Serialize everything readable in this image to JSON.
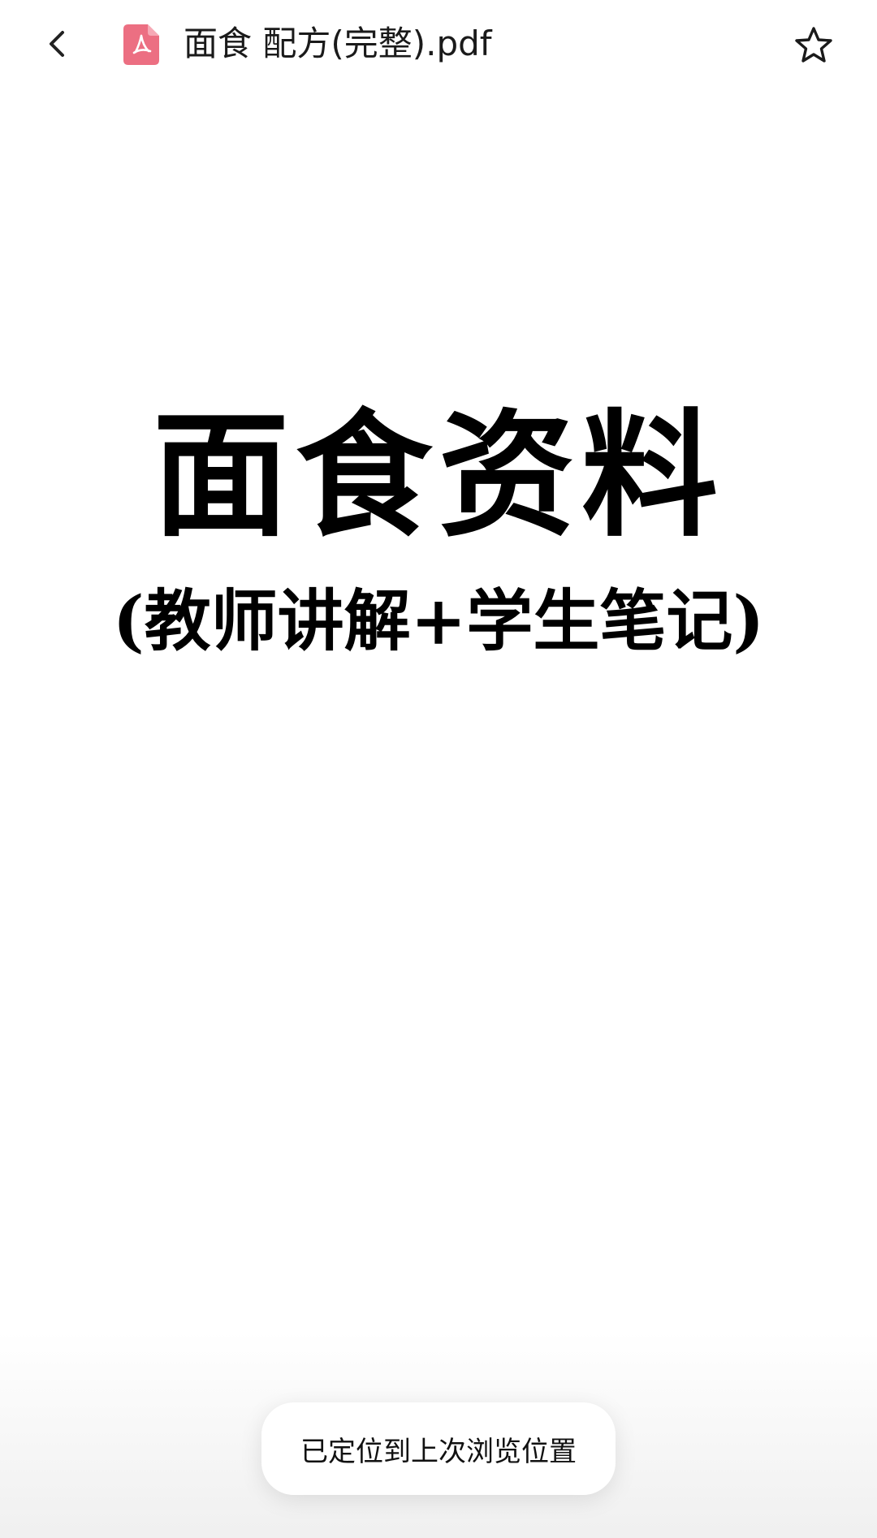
{
  "header": {
    "back_icon": "chevron-left-icon",
    "file_icon": "pdf-file-icon",
    "file_icon_color": "#e8677a",
    "title": "面食 配方(完整).pdf",
    "favorite_icon": "star-outline-icon"
  },
  "document": {
    "title": "面食资料",
    "subtitle": "(教师讲解+学生笔记)"
  },
  "toast": {
    "message": "已定位到上次浏览位置"
  }
}
